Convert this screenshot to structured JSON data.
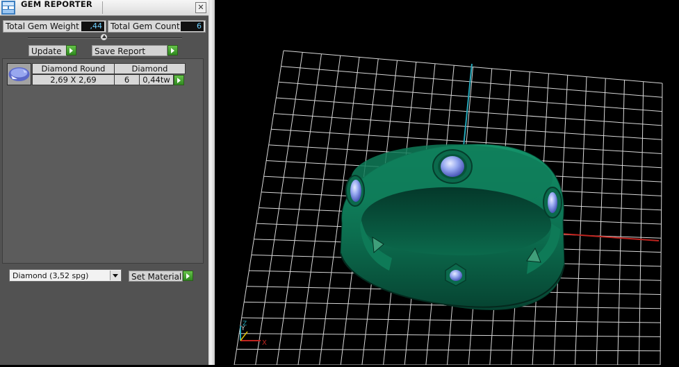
{
  "panel": {
    "title": "GEM REPORTER",
    "close_glyph": "✕",
    "total_weight_label": "Total Gem Weight",
    "total_weight_value": ",44",
    "total_count_label": "Total Gem Count",
    "total_count_value": "6",
    "update_label": "Update",
    "save_report_label": "Save Report",
    "gem_row": {
      "header_name": "Diamond Round",
      "header_material": "Diamond",
      "size": "2,69 X 2,69",
      "count": "6",
      "weight": "0,44tw"
    },
    "material_select_value": "Diamond     (3,52 spg)",
    "set_material_label": "Set Material"
  },
  "viewport": {
    "axis_labels": {
      "x": "X",
      "y": "Y",
      "z": "Z"
    }
  },
  "icons": {
    "app": "gem-reporter-app-icon",
    "close": "close-icon",
    "play": "green-play-icon",
    "dropdown": "chevron-down-icon",
    "gem": "round-diamond-icon"
  },
  "colors": {
    "panel_bg": "#525252",
    "value_text": "#6fd0ff",
    "action_green": "#3fa12c",
    "ring_green": "#0f7a56",
    "gem_blue": "#8fa3e6",
    "grid": "#d8d8d8",
    "axis_cyan": "#25a6b8",
    "axis_red": "#c0241f"
  }
}
